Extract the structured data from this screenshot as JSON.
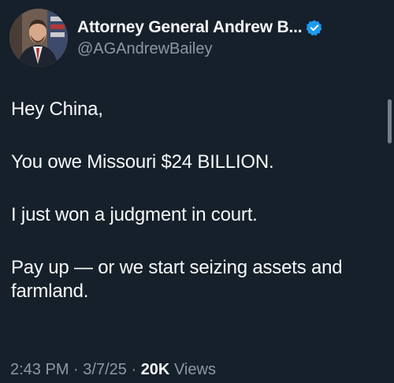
{
  "author": {
    "display_name": "Attorney General Andrew B...",
    "handle": "@AGAndrewBailey",
    "verified_icon": "verified-badge-icon",
    "avatar_icon": "avatar"
  },
  "tweet": {
    "paragraphs": [
      "Hey China,",
      "You owe Missouri $24 BILLION.",
      "I just won a judgment in court.",
      "Pay up — or we start seizing assets and farmland."
    ]
  },
  "meta": {
    "time": "2:43 PM",
    "separator": "·",
    "date": "3/7/25",
    "views_count": "20K",
    "views_label": "Views"
  },
  "colors": {
    "background": "#15202b",
    "text_primary": "#f7f9f9",
    "text_secondary": "#8b98a5",
    "verified_blue": "#1d9bf0"
  }
}
